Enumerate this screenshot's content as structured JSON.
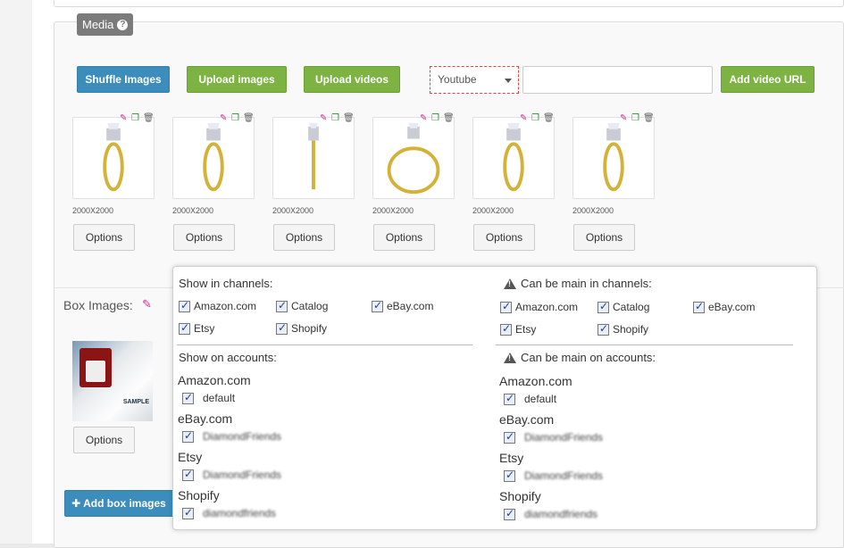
{
  "media": {
    "tag_label": "Media",
    "buttons": {
      "shuffle": "Shuffle Images",
      "upload_images": "Upload images",
      "upload_videos": "Upload videos",
      "add_video_url": "Add video URL"
    },
    "video_source": {
      "selected": "Youtube"
    },
    "video_url_input": {
      "value": ""
    },
    "images": [
      {
        "size": "2000X2000",
        "options_label": "Options"
      },
      {
        "size": "2000X2000",
        "options_label": "Options"
      },
      {
        "size": "2000X2000",
        "options_label": "Options"
      },
      {
        "size": "2000X2000",
        "options_label": "Options"
      },
      {
        "size": "2000X2000",
        "options_label": "Options"
      },
      {
        "size": "2000X2000",
        "options_label": "Options"
      }
    ]
  },
  "box_images": {
    "title": "Box Images:",
    "options_label": "Options",
    "add_button": "Add box images",
    "sample_text": "SAMPLE"
  },
  "popup": {
    "show_channels": {
      "title": "Show in channels:",
      "items": [
        "Amazon.com",
        "Catalog",
        "eBay.com",
        "Etsy",
        "Shopify"
      ]
    },
    "main_channels": {
      "title": "Can be main in channels:",
      "items": [
        "Amazon.com",
        "Catalog",
        "eBay.com",
        "Etsy",
        "Shopify"
      ]
    },
    "show_accounts": {
      "title": "Show on accounts:",
      "groups": [
        {
          "name": "Amazon.com",
          "account": "default"
        },
        {
          "name": "eBay.com",
          "account": "DiamondFriends"
        },
        {
          "name": "Etsy",
          "account": "DiamondFriends"
        },
        {
          "name": "Shopify",
          "account": "diamondfriends"
        }
      ]
    },
    "main_accounts": {
      "title": "Can be main on accounts:",
      "groups": [
        {
          "name": "Amazon.com",
          "account": "default"
        },
        {
          "name": "eBay.com",
          "account": "DiamondFriends"
        },
        {
          "name": "Etsy",
          "account": "DiamondFriends"
        },
        {
          "name": "Shopify",
          "account": "diamondfriends"
        }
      ]
    }
  }
}
